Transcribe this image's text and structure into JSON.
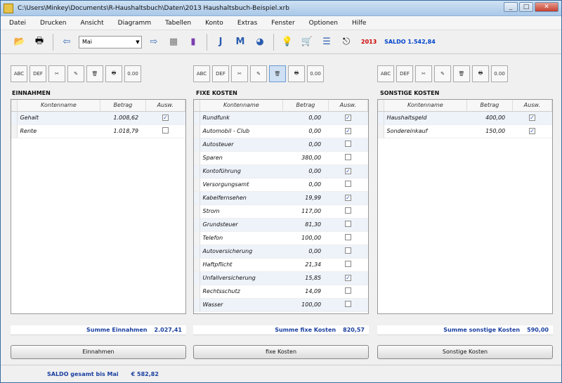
{
  "window": {
    "title": "C:\\Users\\Minkey\\Documents\\R-Haushaltsbuch\\Daten\\2013 Haushaltsbuch-Beispiel.xrb"
  },
  "menu": [
    "Datei",
    "Drucken",
    "Ansicht",
    "Diagramm",
    "Tabellen",
    "Konto",
    "Extras",
    "Fenster",
    "Optionen",
    "Hilfe"
  ],
  "toolbar": {
    "month": "Mai",
    "year": "2013",
    "saldo_label": "SALDO 1.542,84"
  },
  "panel_buttons": [
    "ABC",
    "DEF",
    "",
    "",
    "",
    "",
    "0.00"
  ],
  "income": {
    "title": "EINNAHMEN",
    "columns": [
      "Kontenname",
      "Betrag",
      "Ausw."
    ],
    "rows": [
      {
        "name": "Gehalt",
        "amount": "1.008,62",
        "checked": true
      },
      {
        "name": "Rente",
        "amount": "1.018,79",
        "checked": false
      }
    ],
    "sum_label": "Summe Einnahmen",
    "sum_value": "2.027,41",
    "button": "Einnahmen"
  },
  "fixed": {
    "title": "FIXE KOSTEN",
    "columns": [
      "Kontenname",
      "Betrag",
      "Ausw."
    ],
    "rows": [
      {
        "name": "Rundfunk",
        "amount": "0,00",
        "checked": true
      },
      {
        "name": "Automobil - Club",
        "amount": "0,00",
        "checked": true
      },
      {
        "name": "Autosteuer",
        "amount": "0,00",
        "checked": false
      },
      {
        "name": "Sparen",
        "amount": "380,00",
        "checked": false
      },
      {
        "name": "Kontoführung",
        "amount": "0,00",
        "checked": true
      },
      {
        "name": "Versorgungsamt",
        "amount": "0,00",
        "checked": false
      },
      {
        "name": "Kabelfernsehen",
        "amount": "19,99",
        "checked": true
      },
      {
        "name": "Strom",
        "amount": "117,00",
        "checked": false
      },
      {
        "name": "Grundsteuer",
        "amount": "81,30",
        "checked": false
      },
      {
        "name": "Telefon",
        "amount": "100,00",
        "checked": false
      },
      {
        "name": "Autoversicherung",
        "amount": "0,00",
        "checked": false
      },
      {
        "name": "Haftpflicht",
        "amount": "21,34",
        "checked": false
      },
      {
        "name": "Unfallversicherung",
        "amount": "15,85",
        "checked": true
      },
      {
        "name": "Rechtsschutz",
        "amount": "14,09",
        "checked": false
      },
      {
        "name": "Wasser",
        "amount": "100,00",
        "checked": false
      }
    ],
    "sum_label": "Summe fixe Kosten",
    "sum_value": "820,57",
    "button": "fixe Kosten"
  },
  "other": {
    "title": "SONSTIGE KOSTEN",
    "columns": [
      "Kontenname",
      "Betrag",
      "Ausw."
    ],
    "rows": [
      {
        "name": "Haushaltsgeld",
        "amount": "400,00",
        "checked": true
      },
      {
        "name": "Sondereinkauf",
        "amount": "150,00",
        "checked": true
      }
    ],
    "sum_label": "Summe sonstige Kosten",
    "sum_value": "590,00",
    "button": "Sonstige Kosten"
  },
  "status": {
    "label": "SALDO gesamt bis Mai",
    "value": "€ 582,82"
  }
}
